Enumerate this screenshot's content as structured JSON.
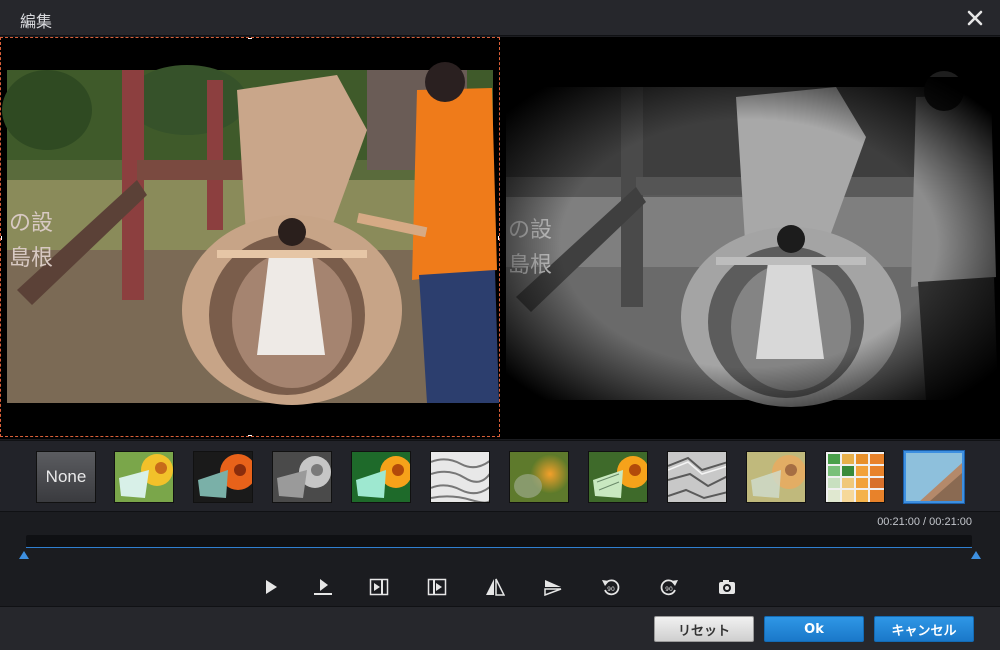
{
  "window": {
    "title": "編集"
  },
  "effects": [
    {
      "label": "None"
    }
  ],
  "timeline": {
    "time_readout": "00:21:00 / 00:21:00"
  },
  "footer": {
    "reset_label": "リセット",
    "ok_label": "Ok",
    "cancel_label": "キャンセル"
  },
  "colors": {
    "accent": "#2f97e6",
    "selection_border": "#d9603a",
    "background": "#1b1c20"
  }
}
